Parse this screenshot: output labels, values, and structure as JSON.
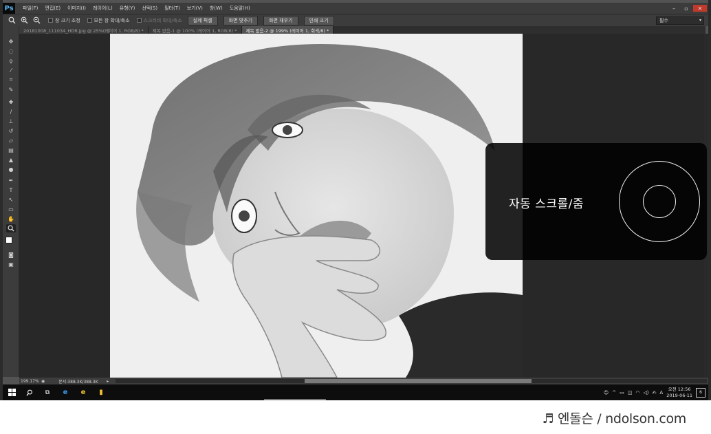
{
  "app": {
    "logo": "Ps"
  },
  "menu": [
    "파일(F)",
    "편집(E)",
    "이미지(I)",
    "레이어(L)",
    "유형(Y)",
    "선택(S)",
    "필터(T)",
    "보기(V)",
    "창(W)",
    "도움말(H)"
  ],
  "window_controls": {
    "minimize": "–",
    "restore": "▫",
    "close": "✕"
  },
  "options": {
    "checks": [
      "창 크기 조정",
      "모든 창 확대/축소"
    ],
    "disabled_check": "스크러비 확대/축소",
    "buttons": [
      "실제 픽셀",
      "화면 맞추기",
      "화면 채우기",
      "인쇄 크기"
    ],
    "workspace": "필수"
  },
  "tabs": [
    {
      "label": "20181008_111034_HDR.jpg @ 25%(레이어 1, RGB/8) *",
      "active": false
    },
    {
      "label": "제목 없음-1 @ 100% (레이어 1, RGB/8) *",
      "active": false
    },
    {
      "label": "제목 없음-2 @ 199% (레이어 1, 회색/8) *",
      "active": true
    }
  ],
  "overlay": {
    "label": "자동 스크롤/줌"
  },
  "status": {
    "zoom": "199.17%",
    "doc_size": "문서:388.3K/388.3K"
  },
  "taskbar": {
    "tray_text": "A",
    "time": "오전 12:56",
    "date": "2019-06-11",
    "notifications": "6"
  },
  "watermark": "♬ 엔돌슨 / ndolson.com",
  "icons": {
    "toolbar": [
      "move-icon",
      "marquee-icon",
      "lasso-icon",
      "quick-select-icon",
      "crop-icon",
      "eyedropper-icon",
      "healing-icon",
      "brush-icon",
      "stamp-icon",
      "history-brush-icon",
      "eraser-icon",
      "gradient-icon",
      "blur-icon",
      "dodge-icon",
      "pen-icon",
      "type-icon",
      "path-select-icon",
      "shape-icon",
      "hand-icon",
      "zoom-icon"
    ]
  }
}
